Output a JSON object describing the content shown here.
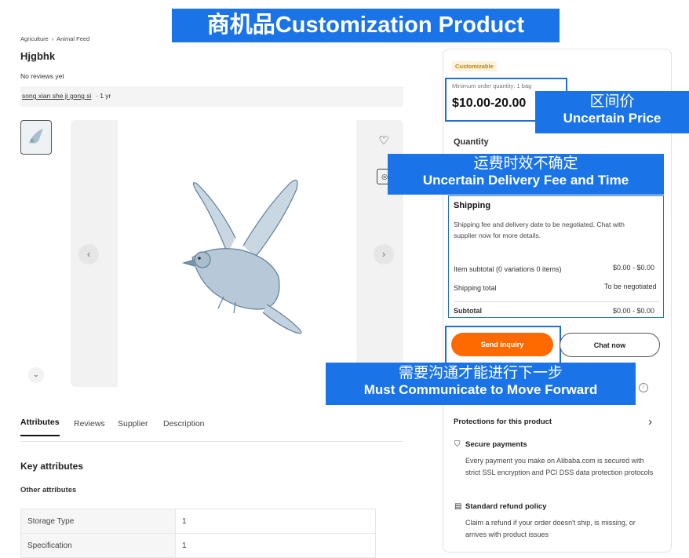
{
  "title_banner": "商机品Customization Product",
  "breadcrumb": {
    "items": [
      "Agriculture",
      "Animal Feed"
    ],
    "sep": "›"
  },
  "product": {
    "name": "Hjgbhk",
    "reviews": "No reviews yet",
    "supplier_link": "song xian she ji gong si",
    "supplier_years": " · 1 yr"
  },
  "tabs": [
    "Attributes",
    "Reviews",
    "Supplier",
    "Description"
  ],
  "attributes": {
    "heading": "Key attributes",
    "subheading": "Other attributes",
    "rows": [
      {
        "key": "Storage Type",
        "value": "1"
      },
      {
        "key": "Specification",
        "value": "1"
      }
    ]
  },
  "panel": {
    "badge": "Customizable",
    "moq": "Minimum order quantity: 1 bag",
    "price": "$10.00-20.00",
    "quantity_label": "Quantity",
    "shipping_title": "Shipping",
    "shipping_note": "Shipping fee and delivery date to be negotiated. Chat with supplier now for more details.",
    "item_subtotal_label": "Item subtotal (0 variations 0 items)",
    "item_subtotal_value": "$0.00 - $0.00",
    "shipping_total_label": "Shipping total",
    "shipping_total_value": "To be negotiated",
    "subtotal_label": "Subtotal",
    "subtotal_value": "$0.00 - $0.00",
    "send_inquiry": "Send inquiry",
    "chat_now": "Chat now",
    "protections_title": "Protections for this product",
    "secure_title": "Secure payments",
    "secure_text": "Every payment you make on Alibaba.com is secured with strict SSL encryption and PCI DSS data protection protocols",
    "refund_title": "Standard refund policy",
    "refund_text": "Claim a refund if your order doesn't ship, is missing, or arrives with product issues"
  },
  "annotations": {
    "price_cn": "区间价",
    "price_en": "Uncertain Price",
    "delivery_cn": "运费时效不确定",
    "delivery_en": "Uncertain Delivery Fee and Time",
    "communicate_cn": "需要沟通才能进行下一步",
    "communicate_en": "Must Communicate to Move Forward"
  },
  "colors": {
    "accent": "#ff6a00",
    "annotation": "#1a74e8"
  }
}
